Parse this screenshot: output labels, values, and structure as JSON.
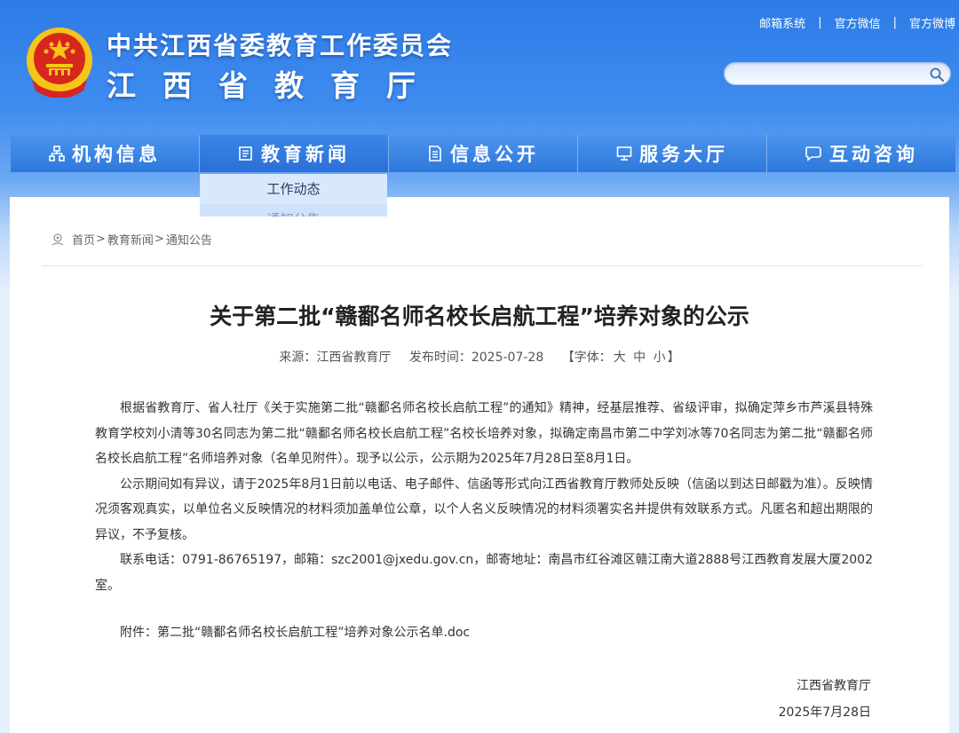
{
  "header": {
    "title_line1": "中共江西省委教育工作委员会",
    "title_line2": "江西省教育厅",
    "top_links": [
      "邮箱系统",
      "官方微信",
      "官方微博"
    ],
    "separator": "|",
    "search_placeholder": ""
  },
  "nav": {
    "items": [
      {
        "label": "机构信息",
        "icon": "org-chart-icon"
      },
      {
        "label": "教育新闻",
        "icon": "news-doc-icon"
      },
      {
        "label": "信息公开",
        "icon": "document-list-icon"
      },
      {
        "label": "服务大厅",
        "icon": "monitor-icon"
      },
      {
        "label": "互动咨询",
        "icon": "chat-bubble-icon"
      }
    ],
    "active_index": 1,
    "dropdown": [
      "工作动态",
      "通知公告"
    ]
  },
  "breadcrumb": {
    "items": [
      "首页",
      "教育新闻",
      "通知公告"
    ],
    "sep": ">"
  },
  "article": {
    "title": "关于第二批“赣鄱名师名校长启航工程”培养对象的公示",
    "source_label": "来源：江西省教育厅",
    "date_label": "发布时间：2025-07-28",
    "font_prefix": "【字体：",
    "font_large": "大",
    "font_medium": "中",
    "font_small": "小",
    "font_suffix": "】",
    "paragraphs": [
      "根据省教育厅、省人社厅《关于实施第二批“赣鄱名师名校长启航工程”的通知》精神，经基层推荐、省级评审，拟确定萍乡市芦溪县特殊教育学校刘小清等30名同志为第二批“赣鄱名师名校长启航工程”名校长培养对象，拟确定南昌市第二中学刘冰等70名同志为第二批“赣鄱名师名校长启航工程”名师培养对象（名单见附件）。现予以公示，公示期为2025年7月28日至8月1日。",
      "公示期间如有异议，请于2025年8月1日前以电话、电子邮件、信函等形式向江西省教育厅教师处反映（信函以到达日邮戳为准）。反映情况须客观真实，以单位名义反映情况的材料须加盖单位公章，以个人名义反映情况的材料须署实名并提供有效联系方式。凡匿名和超出期限的异议，不予复核。",
      "联系电话：0791-86765197，邮箱：szc2001@jxedu.gov.cn，邮寄地址：南昌市红谷滩区赣江南大道2888号江西教育发展大厦2002室。"
    ],
    "attachment": "附件：第二批“赣鄱名师名校长启航工程”培养对象公示名单.doc",
    "sign_org": "江西省教育厅",
    "sign_date": "2025年7月28日"
  },
  "colors": {
    "brand_blue": "#2e78dc",
    "emblem_red": "#d7261e",
    "emblem_gold": "#f5c518"
  }
}
